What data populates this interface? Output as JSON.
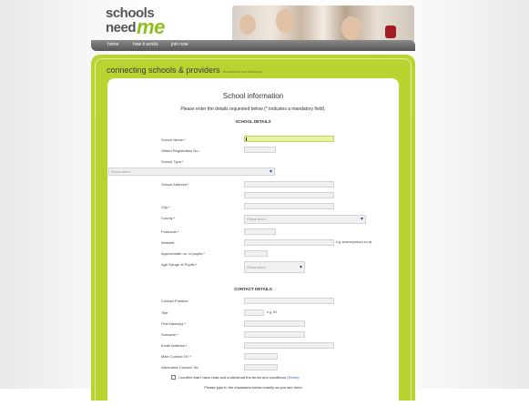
{
  "brand": {
    "logo_line1": "schools",
    "logo_line2": "need",
    "logo_accent": "me"
  },
  "nav": {
    "items": [
      "home",
      "how it works",
      "join now"
    ]
  },
  "tagline": {
    "main": "connecting schools & providers",
    "small": "of resources and workshops"
  },
  "form": {
    "title": "School information",
    "intro": "Please enter the details requested below (* indicates a mandatory field).",
    "section_school": "SCHOOL DETAILS",
    "section_contact": "CONTACT DETAILS",
    "school_name_label": "School Name:*",
    "ofsted_label": "Ofsted Registration No.:",
    "school_type_label": "School Type:*",
    "school_type_placeholder": "Please select",
    "address_label": "School Address:*",
    "city_label": "City:*",
    "county_label": "County:*",
    "county_placeholder": "Please select",
    "postcode_label": "Postcode:*",
    "website_label": "Website:",
    "website_hint": "e.g. www.myschool.co.uk",
    "pupils_label": "Approximate no. of pupils:*",
    "age_label": "Age Range of Pupils:*",
    "age_placeholder": "Please select",
    "contact_position_label": "Contact Position:",
    "title_label": "Title:",
    "title_hint": "e.g. Mr",
    "first_name_label": "First Name(s):*",
    "surname_label": "Surname:*",
    "email_label": "Email Address:*",
    "main_tel_label": "Main Contact Tel.:*",
    "alt_tel_label": "Alternative Contact Tel.:",
    "confirm_text": "I confirm that I have read and understood the terms and conditions",
    "terms_link": "(Terms)",
    "bottom_note": "Please type in the characters below exactly as you see them"
  },
  "colors": {
    "brand_green": "#b9d431",
    "active_field": "#e5f59b",
    "nav_gray": "#6a6a6a",
    "link_blue": "#3c56a6"
  }
}
